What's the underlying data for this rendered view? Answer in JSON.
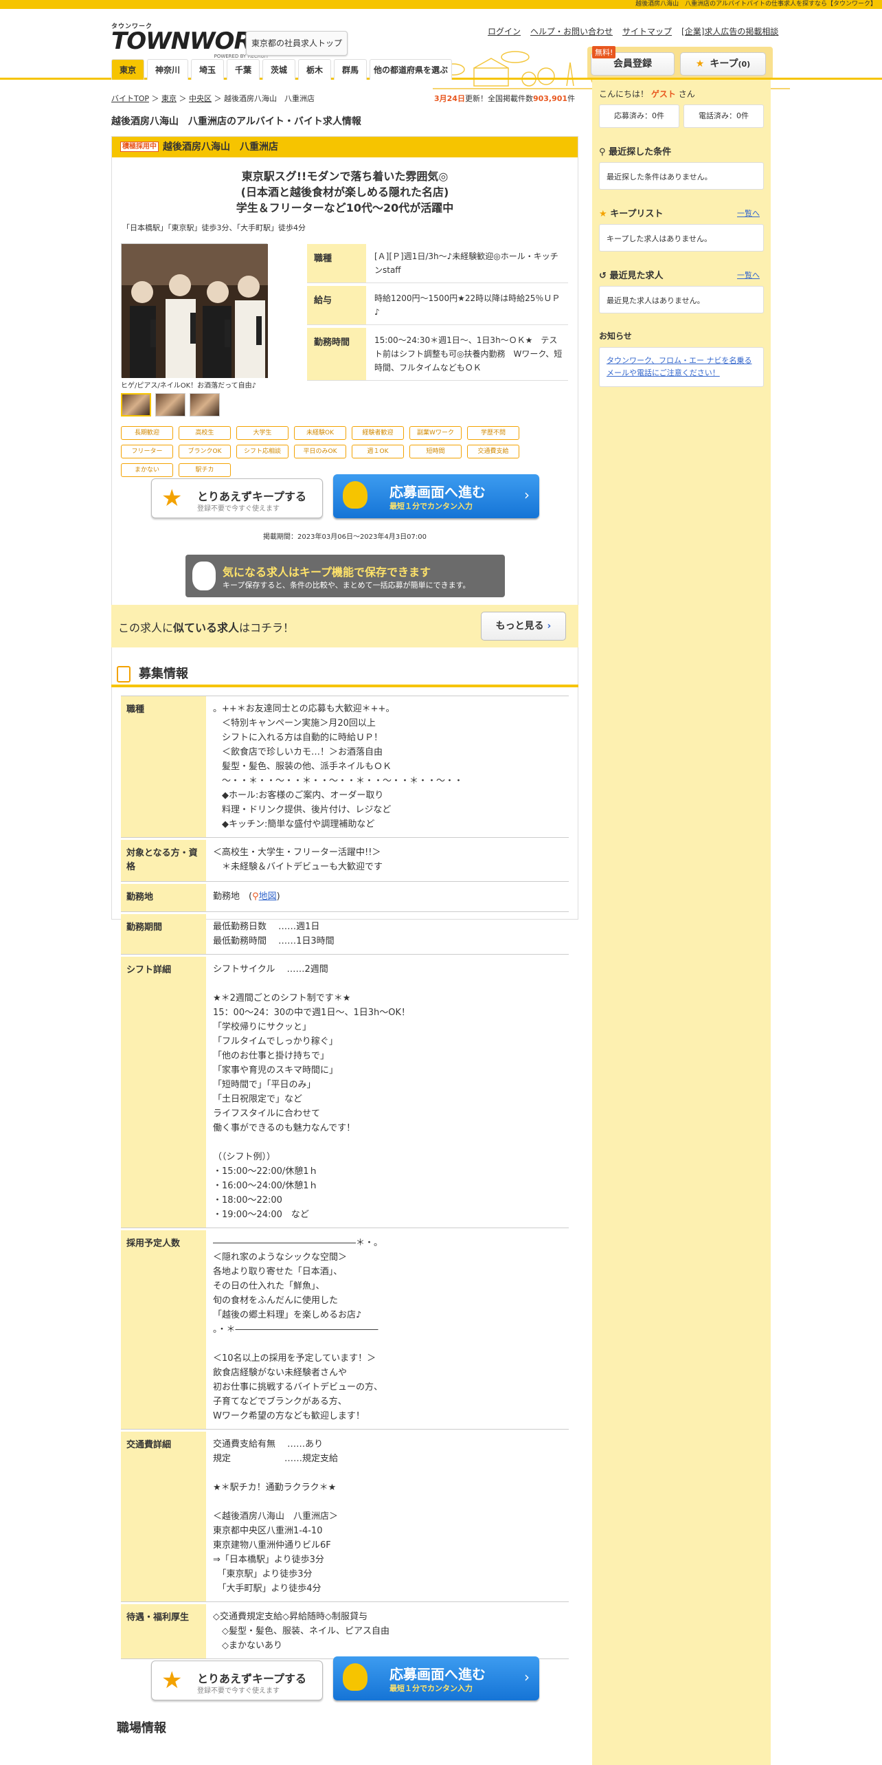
{
  "top_strip": "越後酒房八海山　八重洲店のアルバイトバイトの仕事求人を探すなら【タウンワーク】",
  "logo": {
    "small": "タウンワーク",
    "main": "TOWNWORK",
    "by": "POWERED BY RECRUIT"
  },
  "region_button": "東京都の社員求人トップ",
  "top_links": [
    "ログイン",
    "ヘルプ・お問い合わせ",
    "サイトマップ",
    "[企業]求人広告の掲載相談"
  ],
  "free_badge": "無料!",
  "member_button": "会員登録",
  "keep_button": {
    "label": "キープ",
    "count": "(0)"
  },
  "nav_tabs": [
    "東京",
    "神奈川",
    "埼玉",
    "千葉",
    "茨城",
    "栃木",
    "群馬",
    "他の都道府県を選ぶ"
  ],
  "breadcrumb": [
    "バイトTOP",
    "東京",
    "中央区",
    "越後酒房八海山　八重洲店"
  ],
  "update": {
    "date": "3月24日",
    "text1": "更新！全国掲載件数",
    "count": "903,901",
    "unit": "件"
  },
  "page_title": "越後酒房八海山　八重洲店のアルバイト・バイト求人情報",
  "card": {
    "badge": "積極採用中",
    "name": "越後酒房八海山　八重洲店",
    "catch": [
      "東京駅スグ!!モダンで落ち着いた雰囲気◎",
      "(日本酒と越後食材が楽しめる隠れた名店)",
      "学生＆フリーターなど10代～20代が活躍中"
    ],
    "access": "「日本橋駅」「東京駅」徒歩3分、「大手町駅」徒歩4分",
    "photo_caption": "ヒゲ/ピアス/ネイルOK！お酒落だって自由♪",
    "job_rows": [
      {
        "label": "職種",
        "value": "[Ａ][Ｐ]週1日/3h～♪未経験歓迎◎ホール・キッチンstaff"
      },
      {
        "label": "給与",
        "value": "時給1200円～1500円★22時以降は時給25％ＵＰ♪"
      },
      {
        "label": "勤務時間",
        "value": "15:00～24:30＊週1日～、1日3h～ＯＫ★　テスト前はシフト調整も可◎扶養内勤務　Wワーク、短時間、フルタイムなどもＯＫ"
      }
    ],
    "tags": [
      "長期歓迎",
      "高校生",
      "大学生",
      "未経験OK",
      "経験者歓迎",
      "副業Wワーク",
      "学歴不問",
      "フリーター",
      "ブランクOK",
      "シフト応相談",
      "平日のみOK",
      "週１OK",
      "短時間",
      "交通費支給",
      "まかない",
      "駅チカ"
    ],
    "keep_btn": {
      "l1": "とりあえずキープする",
      "l2": "登録不要で今すぐ使えます"
    },
    "apply_btn": {
      "l1": "応募画面へ進む",
      "l2": "最短１分でカンタン入力"
    },
    "period": "掲載期間：2023年03月06日～2023年4月3日07:00",
    "keep_info": {
      "l1": "気になる求人はキープ機能で保存できます",
      "l2": "キープ保存すると、条件の比較や、まとめて一括応募が簡単にできます。"
    }
  },
  "similar": {
    "pre": "この求人に",
    "bold": "似ている求人",
    "post": "はコチラ！",
    "more": "もっと見る"
  },
  "recruit_title": "募集情報",
  "recruit_rows": [
    {
      "label": "職種",
      "value": "。++＊お友達同士との応募も大歓迎＊++。\n　＜特別キャンペーン実施＞月20回以上\n　シフトに入れる方は自動的に時給ＵＰ！\n　＜飲食店で珍しいカモ…！＞お酒落自由\n　髪型・髪色、服装の他、派手ネイルもＯＫ\n　～・・＊・・～・・＊・・～・・＊・・～・・＊・・～・・\n　◆ホール:お客様のご案内、オーダー取り\n　料理・ドリンク提供、後片付け、レジなど\n　◆キッチン:簡単な盛付や調理補助など"
    },
    {
      "label": "対象となる方・資格",
      "value": "＜高校生・大学生・フリーター活躍中!!＞\n　＊未経験＆バイトデビューも大歓迎です"
    },
    {
      "label": "勤務地",
      "value": "勤務地"
    },
    {
      "label": "勤務期間",
      "value": "最低勤務日数　 ……週1日\n最低勤務時間　 ……1日3時間"
    },
    {
      "label": "シフト詳細",
      "value": "シフトサイクル　 ……2週間\n\n★＊2週間ごとのシフト制です＊★\n15：00～24：30の中で週1日～、1日3h～OK！\n「学校帰りにサクッと」\n「フルタイムでしっかり稼ぐ」\n「他のお仕事と掛け持ちで」\n「家事や育児のスキマ時間に」\n「短時間で」「平日のみ」\n「土日祝限定で」など\nライフスタイルに合わせて\n働く事ができるのも魅力なんです！\n\n（（シフト例））\n・15:00～22:00/休憩1ｈ\n・16:00～24:00/休憩1ｈ\n・18:00～22:00\n・19:00～24:00　など"
    },
    {
      "label": "採用予定人数",
      "value": "――――――――――――――――＊・。\n＜隠れ家のようなシックな空間＞\n各地より取り寄せた「日本酒」、\nその日の仕入れた「鮮魚」、\n旬の食材をふんだんに使用した\n「越後の郷土料理」を楽しめるお店♪\n。・＊――――――――――――――――\n\n＜10名以上の採用を予定しています！＞\n飲食店経験がない未経験者さんや\n初お仕事に挑戦するバイトデビューの方、\n子育てなどでブランクがある方、\nWワーク希望の方なども歓迎します！"
    },
    {
      "label": "交通費詳細",
      "value": "交通費支給有無　 ……あり\n規定　　　　　　……規定支給\n\n★＊駅チカ！通勤ラクラク＊★\n\n＜越後酒房八海山　八重洲店＞\n東京都中央区八重洲1-4-10\n東京建物八重洲仲通りビル6F\n⇒「日本橋駅」より徒歩3分\n　「東京駅」より徒歩3分\n　「大手町駅」より徒歩4分"
    },
    {
      "label": "待遇・福利厚生",
      "value": "◇交通費規定支給◇昇給随時◇制服貸与\n　◇髪型・髪色、服装、ネイル、ピアス自由\n　◇まかないあり"
    }
  ],
  "map_link": "地図",
  "workplace_title": "職場情報",
  "sidebar": {
    "hello_pre": "こんにちは！",
    "guest": "ゲスト",
    "hello_post": "さん",
    "applied": "応募済み：0件",
    "called": "電話済み：0件",
    "recent_search_title": "最近探した条件",
    "recent_search_empty": "最近探した条件はありません。",
    "keep_list_title": "キープリスト",
    "keep_list_empty": "キープした求人はありません。",
    "recent_view_title": "最近見た求人",
    "recent_view_empty": "最近見た求人はありません。",
    "more": "一覧へ",
    "notice_title": "お知らせ",
    "notice_text": "タウンワーク、フロム・エー ナビを名乗るメールや電話にご注意ください！"
  }
}
